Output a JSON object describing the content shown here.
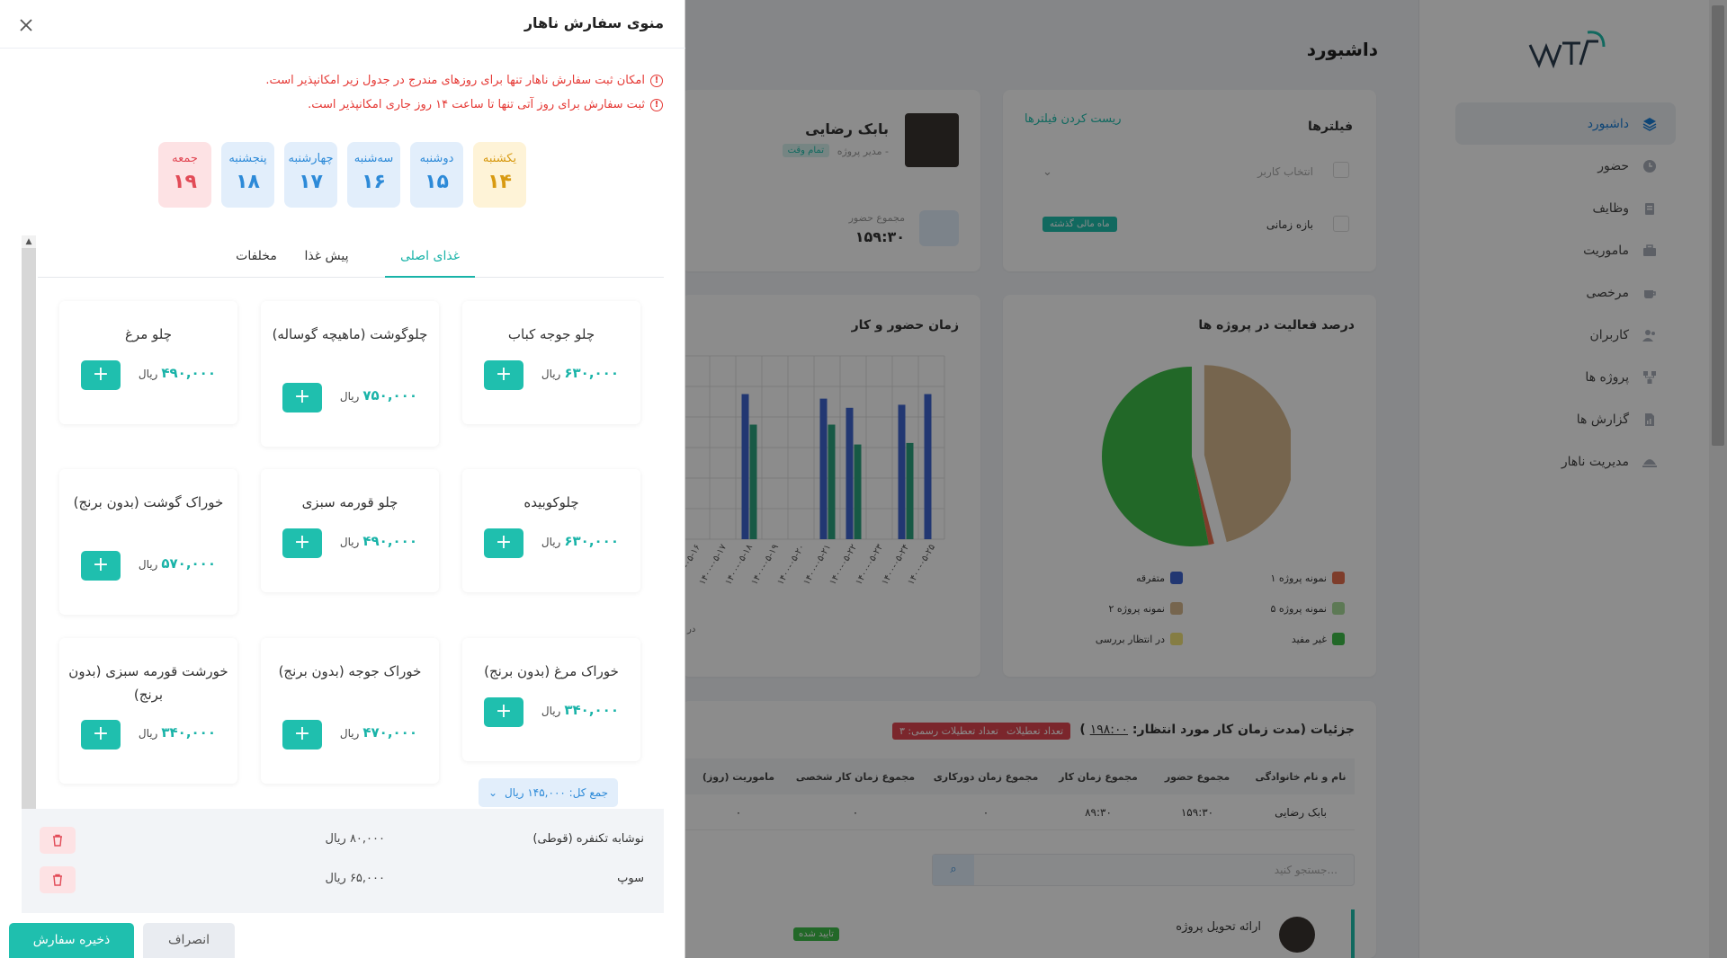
{
  "dashboard": {
    "title": "داشبورد",
    "menu": [
      {
        "label": "داشبورد",
        "icon": "layers-icon",
        "active": true
      },
      {
        "label": "حضور",
        "icon": "clock-icon"
      },
      {
        "label": "وظایف",
        "icon": "clipboard-icon"
      },
      {
        "label": "ماموریت",
        "icon": "briefcase-icon"
      },
      {
        "label": "مرخصی",
        "icon": "coffee-icon"
      },
      {
        "label": "کاربران",
        "icon": "users-icon"
      },
      {
        "label": "پروژه ها",
        "icon": "network-icon"
      },
      {
        "label": "گزارش ها",
        "icon": "report-icon"
      },
      {
        "label": "مدیریت ناهار",
        "icon": "food-cover-icon"
      }
    ],
    "filters": {
      "title": "فیلترها",
      "reset": "ریست کردن فیلترها",
      "user_placeholder": "انتخاب کاربر",
      "range_label": "بازه زمانی",
      "range_badge": "ماه مالی گذشته"
    },
    "user": {
      "name": "بابک رضایی",
      "role": "مدیر پروژه -",
      "badge": "تمام وقت",
      "attendance_label": "مجموع حضور",
      "attendance_value": "۱۵۹:۳۰"
    },
    "pie": {
      "title": "درصد فعالیت در پروژه ها",
      "legend": [
        {
          "label": "نمونه پروژه ۱",
          "color": "#e5704f"
        },
        {
          "label": "متفرقه",
          "color": "#3e64d0"
        },
        {
          "label": "نمونه پروژه ۵",
          "color": "#a9dd9b"
        },
        {
          "label": "نمونه پروژه ۲",
          "color": "#d7b98e"
        },
        {
          "label": "غیر مفید",
          "color": "#3fbe4a"
        },
        {
          "label": "در انتظار بررسی",
          "color": "#f2e37a"
        }
      ]
    },
    "bar": {
      "title": "زمان حضور و کار",
      "axis_note": "در"
    },
    "table": {
      "title": "جزئیات (مدت زمان کار مورد انتظار:",
      "expected": "۱۹۸:۰۰",
      "close_paren": ")",
      "badge1": "تعداد تعطیلات جمعه: ۴",
      "badge2": "تعداد تعطیلات رسمی: ۳",
      "headers": [
        "نام و نام خانوادگی",
        "مجموع حضور",
        "مجموع زمان کار",
        "مجموع زمان دورکاری",
        "مجموع زمان کار شخصی",
        "ماموریت (روز)"
      ],
      "row": [
        "بابک رضایی",
        "۱۵۹:۳۰",
        "۸۹:۳۰",
        "۰",
        "۰",
        "۰"
      ],
      "search_placeholder": "جستجو کنید...",
      "task_title": "ارائه تحویل پروژه",
      "task_badge": "تایید شده"
    }
  },
  "chart_data": {
    "type": "bar",
    "title": "زمان حضور و کار",
    "categories": [
      "۱۴۰۰-۰۵-۱۶",
      "۱۴۰۰-۰۵-۱۷",
      "۱۴۰۰-۰۵-۱۸",
      "۱۴۰۰-۰۵-۱۹",
      "۱۴۰۰-۰۵-۲۰",
      "۱۴۰۰-۰۵-۲۱",
      "۱۴۰۰-۰۵-۲۲",
      "۱۴۰۰-۰۵-۲۳",
      "۱۴۰۰-۰۵-۲۴",
      "۱۴۰۰-۰۵-۲۵"
    ],
    "series": [
      {
        "values": [
          0,
          0,
          9.5,
          0,
          0,
          9.2,
          8.6,
          0,
          8.8,
          9.5
        ]
      },
      {
        "values": [
          0,
          0,
          7.5,
          0,
          0,
          7.5,
          6.2,
          0,
          6.3,
          0
        ]
      }
    ],
    "colors": [
      "#3e64d0",
      "#2aa37f"
    ]
  },
  "pie_data": {
    "type": "pie",
    "values": [
      46,
      1,
      53
    ],
    "colors": [
      "#d7b98e",
      "#e5704f",
      "#3fbe4a"
    ]
  },
  "drawer": {
    "title": "منوی سفارش ناهار",
    "notice1": "امکان ثبت سفارش ناهار تنها برای روزهای مندرج در جدول زیر امکانپذیر است.",
    "notice2": "ثبت سفارش برای روز آتی تنها تا ساعت ۱۴ روز جاری امکانپذیر است.",
    "days": [
      {
        "name": "یکشنبه",
        "date": "۱۴",
        "color": "yellow"
      },
      {
        "name": "دوشنبه",
        "date": "۱۵",
        "color": "blue"
      },
      {
        "name": "سه‌شنبه",
        "date": "۱۶",
        "color": "blue"
      },
      {
        "name": "چهارشنبه",
        "date": "۱۷",
        "color": "blue"
      },
      {
        "name": "پنجشنبه",
        "date": "۱۸",
        "color": "blue"
      },
      {
        "name": "جمعه",
        "date": "۱۹",
        "color": "red"
      }
    ],
    "tabs": [
      "غذای اصلی",
      "پیش غذا",
      "مخلفات"
    ],
    "currency": "ریال",
    "foods": [
      {
        "name": "چلو جوجه کباب",
        "price": "۶۳۰,۰۰۰"
      },
      {
        "name": "چلوگوشت (ماهیچه گوساله)",
        "price": "۷۵۰,۰۰۰"
      },
      {
        "name": "چلو مرغ",
        "price": "۴۹۰,۰۰۰"
      },
      {
        "name": "چلوکوبیده",
        "price": "۶۳۰,۰۰۰"
      },
      {
        "name": "چلو قورمه سبزی",
        "price": "۴۹۰,۰۰۰"
      },
      {
        "name": "خوراک گوشت (بدون برنج)",
        "price": "۵۷۰,۰۰۰"
      },
      {
        "name": "خوراک مرغ (بدون برنج)",
        "price": "۳۴۰,۰۰۰"
      },
      {
        "name": "خوراک جوجه (بدون برنج)",
        "price": "۴۷۰,۰۰۰"
      },
      {
        "name": "خورشت قورمه سبزی (بدون برنج)",
        "price": "۳۴۰,۰۰۰"
      }
    ],
    "total": "جمع کل: ۱۴۵,۰۰۰ ریال",
    "order_items": [
      {
        "name": "نوشابه تکنفره (قوطی)",
        "price": "۸۰,۰۰۰ ریال"
      },
      {
        "name": "سوپ",
        "price": "۶۵,۰۰۰ ریال"
      }
    ],
    "save_label": "ذخیره سفارش",
    "cancel_label": "انصراف"
  }
}
